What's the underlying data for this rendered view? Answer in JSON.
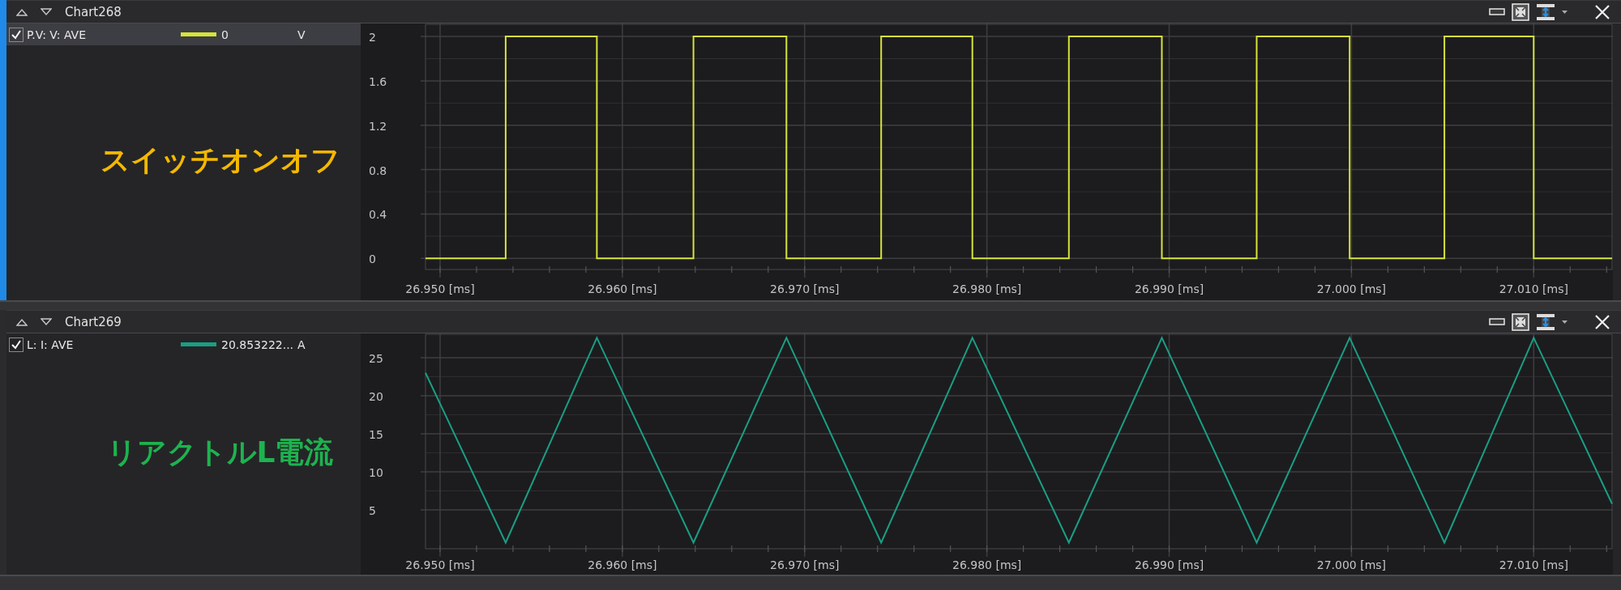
{
  "panels": [
    {
      "title": "Chart268",
      "selected": true,
      "legend": [
        {
          "checked": true,
          "value": "0",
          "unit": "V"
        }
      ],
      "annotation": {
        "text": "スイッチオンオフ",
        "color": "#f5b800"
      },
      "chart_data": {
        "type": "line",
        "x": [
          26.9492,
          26.9536,
          26.9536,
          26.9586,
          26.9586,
          26.9639,
          26.9639,
          26.969,
          26.969,
          26.9742,
          26.9742,
          26.9792,
          26.9792,
          26.9845,
          26.9845,
          26.9896,
          26.9896,
          26.9948,
          26.9948,
          26.9999,
          26.9999,
          27.0051,
          27.0051,
          27.01,
          27.01,
          27.0143
        ],
        "series": [
          {
            "name": "P.V: V: AVE",
            "color": "#d6e33a",
            "values": [
              0,
              0,
              2,
              2,
              0,
              0,
              2,
              2,
              0,
              0,
              2,
              2,
              0,
              0,
              2,
              2,
              0,
              0,
              2,
              2,
              0,
              0,
              2,
              2,
              0,
              0
            ]
          }
        ],
        "grid": true,
        "xlim": [
          26.9492,
          27.0143
        ],
        "ylim": [
          -0.1,
          2.11
        ],
        "xticks": [
          {
            "value": 26.95,
            "label": "26.950 [ms]"
          },
          {
            "value": 26.96,
            "label": "26.960 [ms]"
          },
          {
            "value": 26.97,
            "label": "26.970 [ms]"
          },
          {
            "value": 26.98,
            "label": "26.980 [ms]"
          },
          {
            "value": 26.99,
            "label": "26.990 [ms]"
          },
          {
            "value": 27.0,
            "label": "27.000 [ms]"
          },
          {
            "value": 27.01,
            "label": "27.010 [ms]"
          }
        ],
        "yticks": [
          0,
          0.4,
          0.8,
          1.2,
          1.6,
          2
        ]
      }
    },
    {
      "title": "Chart269",
      "selected": false,
      "legend": [
        {
          "checked": true,
          "value": "20.853222...",
          "unit": "A"
        }
      ],
      "annotation": {
        "text": "リアクトルL電流",
        "color": "#1db34f"
      },
      "chart_data": {
        "type": "line",
        "x": [
          26.9492,
          26.9536,
          26.9586,
          26.9639,
          26.969,
          26.9742,
          26.9792,
          26.9845,
          26.9896,
          26.9948,
          26.9999,
          27.0051,
          27.01,
          27.0143
        ],
        "series": [
          {
            "name": "L: I: AVE",
            "color": "#1a9e84",
            "values": [
              23,
              0.7,
              27.6,
              0.7,
              27.6,
              0.7,
              27.6,
              0.7,
              27.6,
              0.7,
              27.6,
              0.7,
              27.6,
              5.8
            ]
          }
        ],
        "grid": true,
        "xlim": [
          26.9492,
          27.0143
        ],
        "ylim": [
          -0.1,
          28.07
        ],
        "xticks": [
          {
            "value": 26.95,
            "label": "26.950 [ms]"
          },
          {
            "value": 26.96,
            "label": "26.960 [ms]"
          },
          {
            "value": 26.97,
            "label": "26.970 [ms]"
          },
          {
            "value": 26.98,
            "label": "26.980 [ms]"
          },
          {
            "value": 26.99,
            "label": "26.990 [ms]"
          },
          {
            "value": 27.0,
            "label": "27.000 [ms]"
          },
          {
            "value": 27.01,
            "label": "27.010 [ms]"
          }
        ],
        "yticks": [
          5,
          10,
          15,
          20,
          25
        ]
      }
    }
  ]
}
